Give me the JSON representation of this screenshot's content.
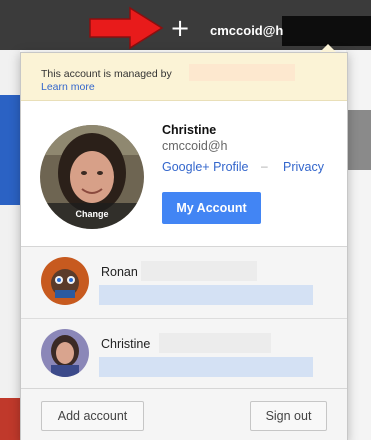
{
  "header": {
    "plus_glyph": "+",
    "account_label": "cmccoid@h"
  },
  "managed_notice": {
    "text": "This account is managed by",
    "learn_more": "Learn more"
  },
  "profile": {
    "name": "Christine",
    "email": "cmccoid@h",
    "change_label": "Change",
    "google_plus_link": "Google+ Profile",
    "separator": "–",
    "privacy_link": "Privacy",
    "my_account_button": "My Account"
  },
  "accounts": [
    {
      "name": "Ronan"
    },
    {
      "name": "Christine"
    }
  ],
  "footer": {
    "add_account": "Add account",
    "sign_out": "Sign out"
  },
  "colors": {
    "arrow": "#e81b1b",
    "primary_button": "#4285f4",
    "link": "#3366cc",
    "notice_background": "#fbf3d6"
  },
  "icons": {
    "add": "plus-icon",
    "annotation": "red-arrow-icon"
  }
}
